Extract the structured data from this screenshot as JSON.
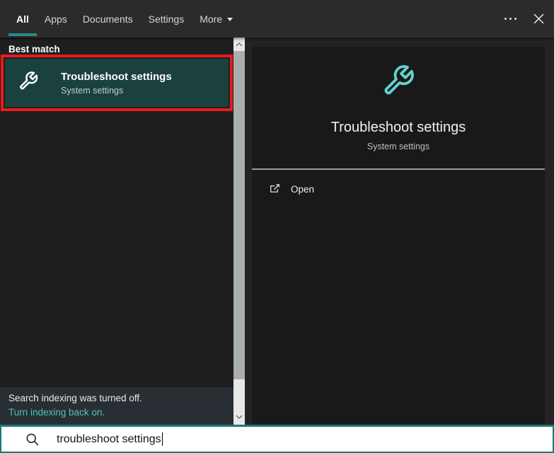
{
  "colors": {
    "accent": "#2b8a88",
    "accent-bright": "#62d2cf",
    "link": "#4fc4bc",
    "tile-bg": "#1a413d",
    "annotation": "#e81b1b",
    "topbar-bg": "#2b2b2b",
    "window-bg": "#232323",
    "panel-bg": "#191919",
    "left-bg": "#1f1f1f",
    "footer-bg": "#282e34",
    "search-border": "#1a7a78",
    "scroll-thumb": "#a9aeae",
    "scroll-track": "#e8e8e8"
  },
  "topbar": {
    "tabs": [
      {
        "label": "All",
        "active": true
      },
      {
        "label": "Apps",
        "active": false
      },
      {
        "label": "Documents",
        "active": false
      },
      {
        "label": "Settings",
        "active": false
      },
      {
        "label": "More",
        "active": false,
        "dropdown": true
      }
    ]
  },
  "left": {
    "section_label": "Best match",
    "result": {
      "title": "Troubleshoot settings",
      "subtitle": "System settings"
    },
    "footer": {
      "message": "Search indexing was turned off.",
      "link": "Turn indexing back on."
    }
  },
  "right": {
    "title": "Troubleshoot settings",
    "subtitle": "System settings",
    "actions": [
      {
        "label": "Open"
      }
    ]
  },
  "search": {
    "value": "troubleshoot settings"
  },
  "icons": {
    "search": "magnifier-icon",
    "result": "wrench-icon",
    "hero": "wrench-icon",
    "open": "open-external-icon",
    "close": "close-icon",
    "see_more": "ellipsis-icon",
    "more_tab": "chevron-down-icon",
    "scroll_up": "chevron-up-icon",
    "scroll_down": "chevron-down-icon"
  }
}
